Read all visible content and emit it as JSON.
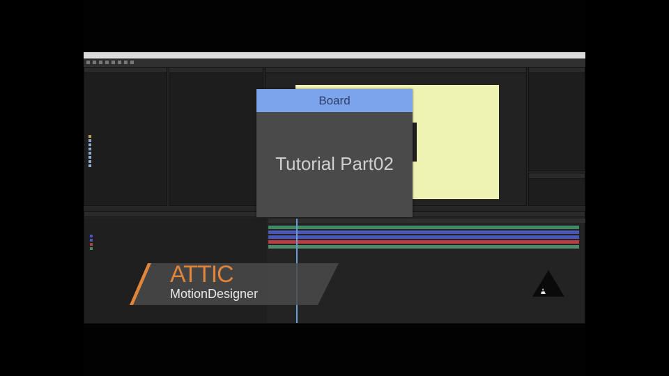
{
  "board": {
    "header": "Board",
    "title": "Tutorial Part02"
  },
  "logo": {
    "brand": "ATTIC",
    "tagline": "MotionDesigner"
  },
  "icons": {
    "badge": "warning-triangle-icon"
  },
  "colors": {
    "board_header": "#7ca4ec",
    "board_body": "#4a4a4a",
    "viewer_canvas": "#eef3b4",
    "logo_accent": "#e0853a",
    "timeline_blue": "#4c56b8",
    "timeline_red": "#b83c44",
    "timeline_green": "#4e8a6a"
  }
}
